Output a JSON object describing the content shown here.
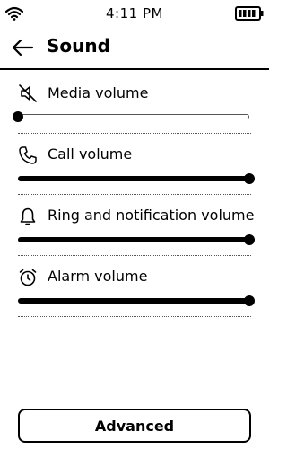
{
  "status_bar": {
    "time": "4:11 PM",
    "wifi_icon": "wifi-icon",
    "battery_icon": "battery-full-icon"
  },
  "header": {
    "title": "Sound",
    "back_icon": "arrow-left-icon"
  },
  "settings": [
    {
      "label": "Media volume",
      "icon": "speaker-muted-icon",
      "level": 0.0
    },
    {
      "label": "Call volume",
      "icon": "phone-icon",
      "level": 1.0
    },
    {
      "label": "Ring and notification volume",
      "icon": "bell-icon",
      "level": 1.0
    },
    {
      "label": "Alarm volume",
      "icon": "alarm-clock-icon",
      "level": 1.0
    }
  ],
  "advanced_button": {
    "label": "Advanced"
  }
}
